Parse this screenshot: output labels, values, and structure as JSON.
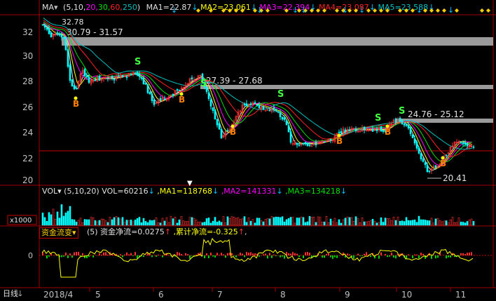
{
  "header": {
    "indicator": "MA",
    "params_open": "(",
    "params": [
      {
        "text": "5,",
        "color": "#e0e0e0"
      },
      {
        "text": "10,",
        "color": "#e0e0e0"
      },
      {
        "text": "20,",
        "color": "#ff00ff"
      },
      {
        "text": "30,",
        "color": "#00e000"
      },
      {
        "text": "60,",
        "color": "#ff2020"
      },
      {
        "text": "250",
        "color": "#00c0c0"
      }
    ],
    "params_close": ")",
    "ma_values": [
      {
        "label": "MA1=22.87",
        "color": "#e0e0e0",
        "arrow": "↓"
      },
      {
        "label": "MA2=23.061",
        "color": "#ffff00",
        "arrow": "↓"
      },
      {
        "label": "MA3=22.394",
        "color": "#ff00ff",
        "arrow": "↓"
      },
      {
        "label": "MA4=23.087",
        "color": "#ff2020",
        "arrow": "↓"
      },
      {
        "label": "MA5=23.588",
        "color": "#00c0c0",
        "arrow": "↓"
      }
    ]
  },
  "price_axis": {
    "ticks": [
      "32",
      "30",
      "28",
      "26",
      "24",
      "22",
      "20"
    ]
  },
  "time_axis": {
    "labels": [
      "2018/4",
      "5",
      "6",
      "7",
      "8",
      "9",
      "10",
      "11"
    ]
  },
  "price_annotations": {
    "high": "32.78",
    "low": "20.41",
    "zones": [
      "30.79 - 31.57",
      "27.39 - 27.68",
      "24.76 - 25.12"
    ]
  },
  "signals": {
    "buy": "B",
    "sell": "S"
  },
  "volume_panel": {
    "name": "VOL",
    "params": "(5,10,20)",
    "values": [
      {
        "label": "VOL=60216",
        "color": "#e0e0e0",
        "arrow": "↓"
      },
      {
        "label": ",MA1=118768",
        "color": "#ffff00",
        "arrow": "↓"
      },
      {
        "label": ",MA2=141331",
        "color": "#ff00ff",
        "arrow": "↓"
      },
      {
        "label": ",MA3=134218",
        "color": "#00e000",
        "arrow": "↓"
      }
    ],
    "unit": "x1000"
  },
  "capital_panel": {
    "name": "资金流变",
    "params": "(5)",
    "values": [
      {
        "label": "资金净流=0.0275",
        "color": "#e0e0e0",
        "arrow": "↑"
      },
      {
        "label": ",累计净流=-0.325",
        "color": "#ffff00",
        "arrow": "↑"
      }
    ],
    "tail": ",",
    "zero_tick": "0"
  },
  "period_label": "日线",
  "colors": {
    "up": "#ff3232",
    "down": "#00ffff",
    "grid": "#a00000",
    "text": "#c0c0c0"
  }
}
